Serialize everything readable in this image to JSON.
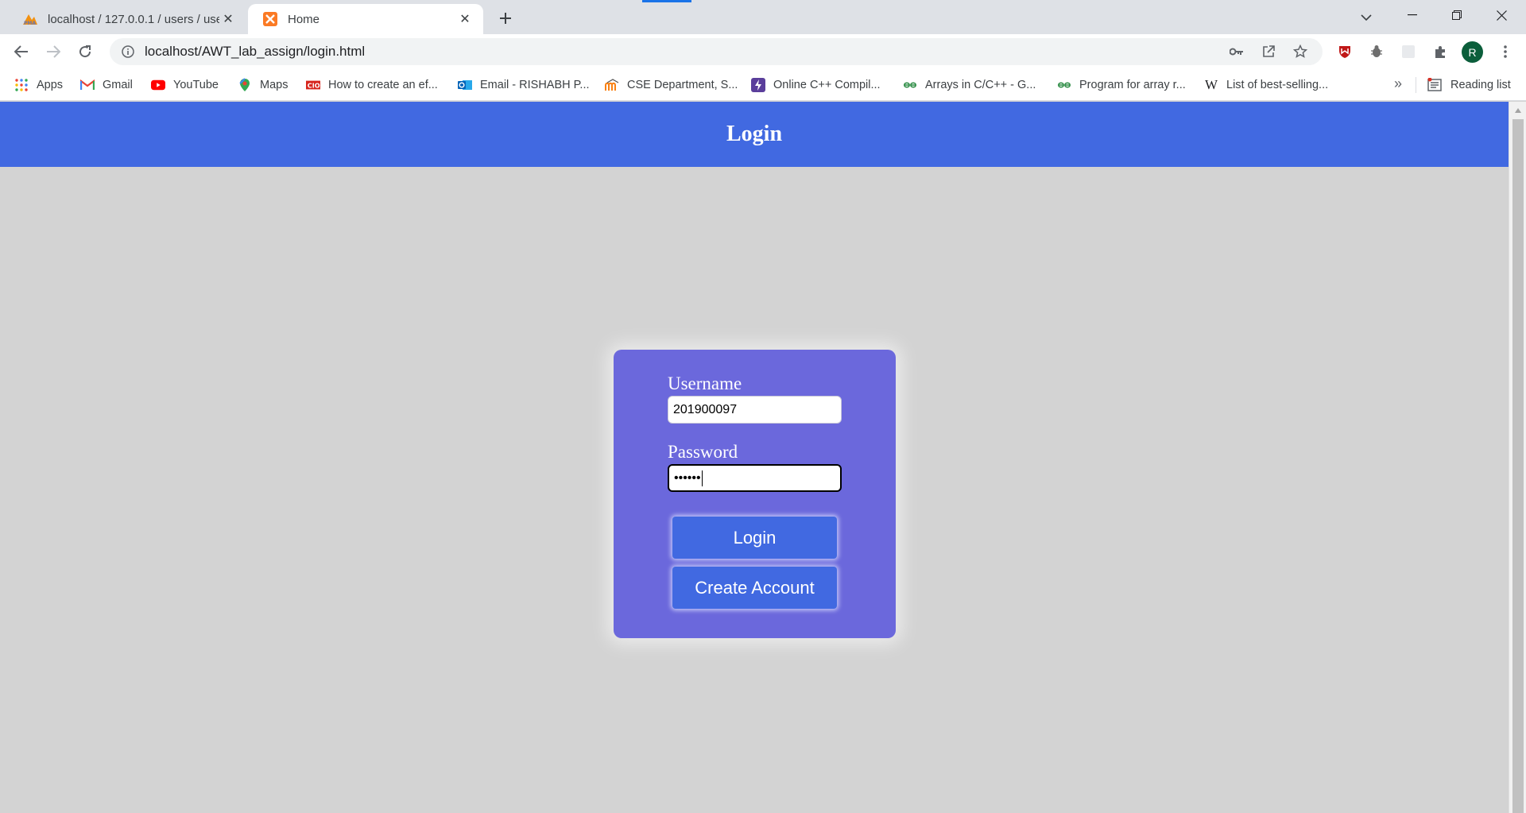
{
  "browser": {
    "tabs": [
      {
        "title": "localhost / 127.0.0.1 / users / use",
        "favicon": "phpmyadmin-icon"
      },
      {
        "title": "Home",
        "favicon": "xampp-icon"
      }
    ],
    "address_url": "localhost/AWT_lab_assign/login.html",
    "avatar_letter": "R",
    "bookmarks": [
      {
        "label": "Apps",
        "icon": "apps-grid-icon"
      },
      {
        "label": "Gmail",
        "icon": "gmail-icon"
      },
      {
        "label": "YouTube",
        "icon": "youtube-icon"
      },
      {
        "label": "Maps",
        "icon": "maps-icon"
      },
      {
        "label": "How to create an ef...",
        "icon": "cio-icon"
      },
      {
        "label": "Email - RISHABH P...",
        "icon": "outlook-icon"
      },
      {
        "label": "CSE Department, S...",
        "icon": "moodle-icon"
      },
      {
        "label": "Online C++ Compil...",
        "icon": "lightning-icon"
      },
      {
        "label": "Arrays in C/C++ - G...",
        "icon": "gfg-icon"
      },
      {
        "label": "Program for array r...",
        "icon": "gfg-icon"
      },
      {
        "label": "List of best-selling...",
        "icon": "wikipedia-icon"
      }
    ],
    "reading_list_label": "Reading list",
    "more_bookmarks": "»"
  },
  "page": {
    "header_title": "Login",
    "form": {
      "username_label": "Username",
      "username_value": "201900097",
      "password_label": "Password",
      "password_value": "••••••",
      "login_button": "Login",
      "create_account_button": "Create Account"
    }
  },
  "colors": {
    "header_bg": "#4169e1",
    "card_bg": "#6b68dc",
    "button_bg": "#4169e1",
    "page_bg": "#d3d3d3"
  }
}
